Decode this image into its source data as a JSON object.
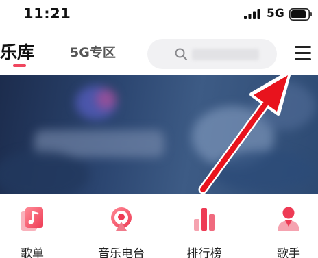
{
  "status_bar": {
    "time": "11:21",
    "network": "5G",
    "signal_icon": "signal-bars-icon",
    "battery_icon": "battery-icon"
  },
  "header": {
    "active_tab": "乐库",
    "tabs": [
      "乐库",
      "5G专区"
    ],
    "search": {
      "icon": "search-icon",
      "placeholder": ""
    },
    "menu_icon": "hamburger-menu-icon"
  },
  "banner": {
    "state": "blurred"
  },
  "bottom_nav": [
    {
      "label": "歌单",
      "icon": "playlist-icon"
    },
    {
      "label": "音乐电台",
      "icon": "radio-icon"
    },
    {
      "label": "排行榜",
      "icon": "chart-icon"
    },
    {
      "label": "歌手",
      "icon": "singer-icon"
    }
  ],
  "colors": {
    "accent": "#f0475f",
    "annotation_arrow": "#e8131d"
  }
}
